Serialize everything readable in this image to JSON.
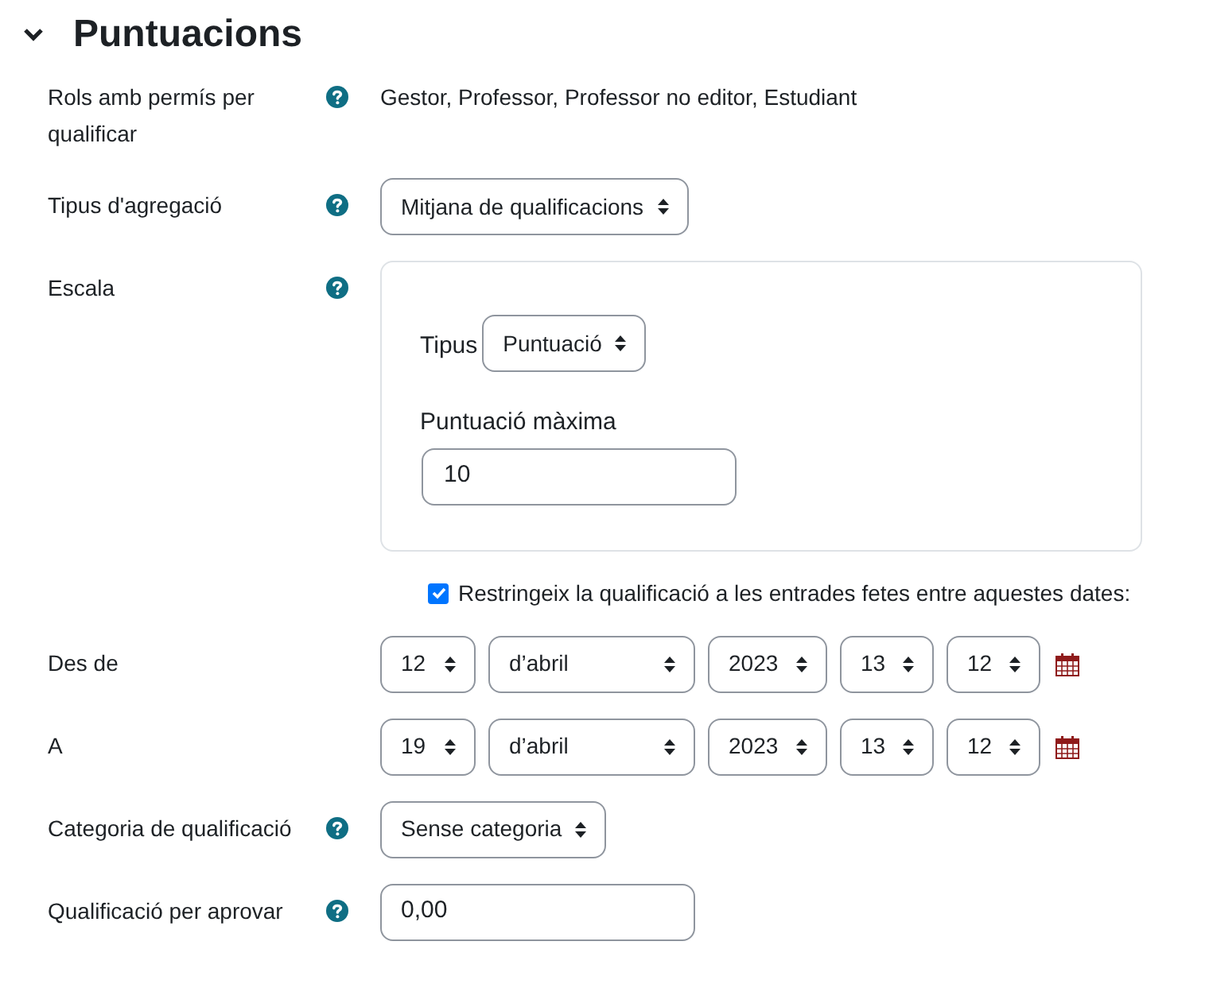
{
  "section": {
    "title": "Puntuacions",
    "expanded": true
  },
  "rows": [
    {
      "kind": "text",
      "label": "Rols amb permís per qualificar",
      "help": true,
      "value": "Gestor, Professor, Professor no editor, Estudiant"
    },
    {
      "kind": "select",
      "label": "Tipus d'agregació",
      "help": true,
      "value": "Mitjana de qualificacions"
    },
    {
      "kind": "scale",
      "label": "Escala",
      "help": true,
      "type_label": "Tipus",
      "type_value": "Puntuació",
      "max_label": "Puntuació màxima",
      "max_value": "10"
    },
    {
      "kind": "checkbox",
      "text": "Restringeix la qualificació a les entrades fetes entre aquestes dates:",
      "checked": true
    },
    {
      "kind": "date",
      "label": "Des de",
      "help": false,
      "day": "12",
      "month": "d’abril",
      "year": "2023",
      "hour": "13",
      "minute": "12"
    },
    {
      "kind": "date",
      "label": "A",
      "help": false,
      "day": "19",
      "month": "d’abril",
      "year": "2023",
      "hour": "13",
      "minute": "12"
    },
    {
      "kind": "select",
      "label": "Categoria de qualificació",
      "help": true,
      "value": "Sense categoria"
    },
    {
      "kind": "input",
      "label": "Qualificació per aprovar",
      "help": true,
      "value": "0,00"
    }
  ]
}
